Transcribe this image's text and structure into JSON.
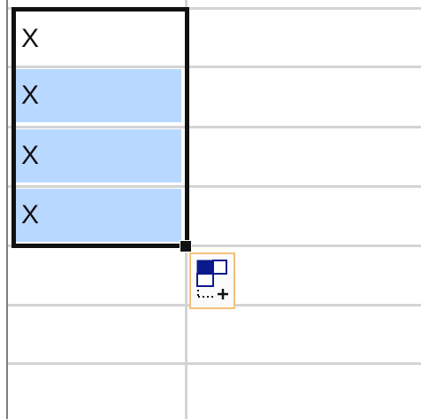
{
  "spreadsheet": {
    "cells": [
      {
        "value": "X",
        "selected": false,
        "active": true
      },
      {
        "value": "X",
        "selected": true,
        "active": false
      },
      {
        "value": "X",
        "selected": true,
        "active": false
      },
      {
        "value": "X",
        "selected": true,
        "active": false
      }
    ],
    "autofill_options_icon": "auto-fill-options-icon",
    "fill_handle_icon": "fill-handle",
    "colors": {
      "selection_fill": "#b8d8ff",
      "selection_border": "#111111",
      "gridline": "#d4d4d4",
      "autofill_border": "#f5c07a",
      "icon_blue": "#0a1a8c"
    }
  }
}
